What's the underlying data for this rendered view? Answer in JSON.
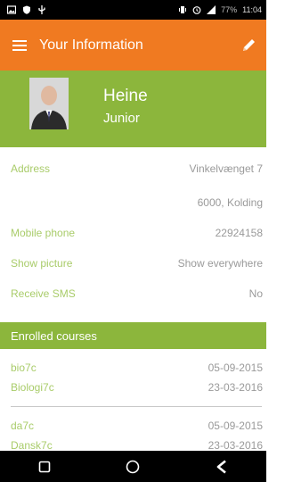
{
  "status_bar": {
    "left_icons": [
      "image-icon",
      "shield-icon",
      "usb-icon"
    ],
    "right_icons": [
      "vibrate-icon",
      "alarm-icon",
      "signal-icon"
    ],
    "battery": "77%",
    "time": "11:04"
  },
  "appbar": {
    "title": "Your Information",
    "menu_icon": "menu-icon",
    "edit_icon": "pencil-icon",
    "color": "#f07a21"
  },
  "profile": {
    "name": "Heine",
    "role": "Junior",
    "color": "#8cb63c"
  },
  "info": {
    "address_label": "Address",
    "address_line1": "Vinkelvænget 7",
    "address_line2": "6000, Kolding",
    "mobile_label": "Mobile phone",
    "mobile_value": "22924158",
    "picture_label": "Show picture",
    "picture_value": "Show everywhere",
    "sms_label": "Receive SMS",
    "sms_value": "No"
  },
  "enrolled": {
    "header": "Enrolled courses",
    "courses": [
      {
        "name": "bio7c",
        "date": "05-09-2015"
      },
      {
        "name": "Biologi7c",
        "date": "23-03-2016"
      },
      {
        "name": "da7c",
        "date": "05-09-2015"
      },
      {
        "name": "Dansk7c",
        "date": "23-03-2016"
      }
    ]
  },
  "navbar": {
    "icons": [
      "recent-apps-icon",
      "home-icon",
      "back-icon"
    ]
  }
}
